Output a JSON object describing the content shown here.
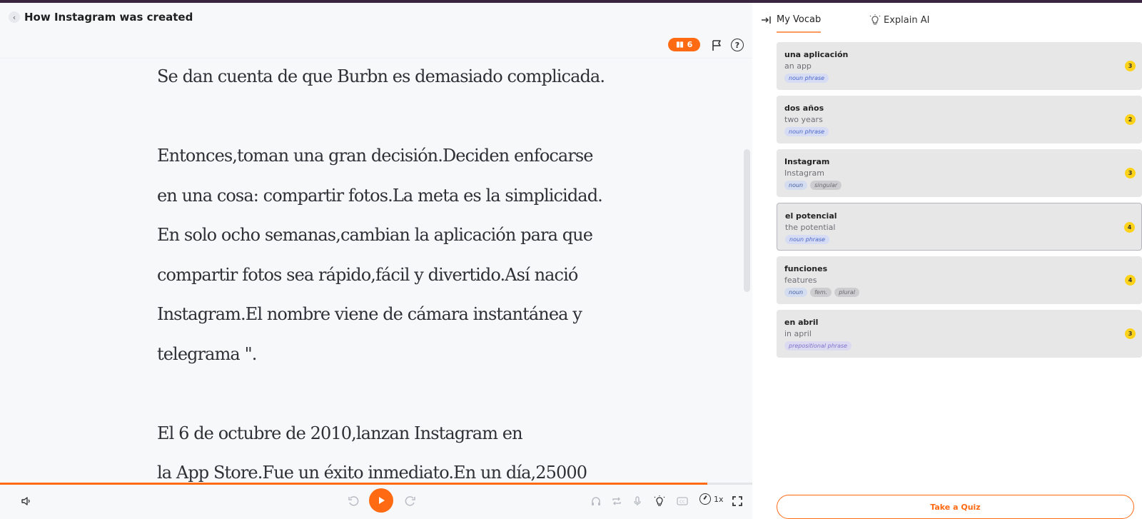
{
  "header": {
    "title": "How Instagram was created",
    "book_count": "6"
  },
  "story": {
    "lines": [
      "Se dan cuenta de que Burbn es demasiado complicada.",
      "",
      "Entonces,toman una gran decisión.Deciden enfocarse",
      "en una cosa: compartir fotos.La meta es la simplicidad.",
      "En solo ocho semanas,cambian la aplicación para que",
      "compartir fotos sea rápido,fácil y divertido.Así nació",
      "Instagram.El nombre viene de cámara instantánea y",
      "telegrama \".",
      "",
      "El 6 de octubre de 2010,lanzan Instagram en",
      "la App Store.Fue un éxito inmediato.En un día,25000"
    ],
    "progress_fraction": 0.94
  },
  "player": {
    "speed_label": "1x"
  },
  "panel": {
    "tab_vocab": "My Vocab",
    "tab_ai": "Explain AI",
    "quiz_label": "Take a Quiz",
    "vocab": [
      {
        "word": "una aplicación",
        "translation": "an app",
        "tags": [
          "noun phrase"
        ],
        "count": "3"
      },
      {
        "word": "dos años",
        "translation": "two years",
        "tags": [
          "noun phrase"
        ],
        "count": "2"
      },
      {
        "word": "Instagram",
        "translation": "Instagram",
        "tags": [
          "noun",
          "singular"
        ],
        "count": "3"
      },
      {
        "word": "el potencial",
        "translation": "the potential",
        "tags": [
          "noun phrase"
        ],
        "count": "4"
      },
      {
        "word": "funciones",
        "translation": "features",
        "tags": [
          "noun",
          "fem.",
          "plural"
        ],
        "count": "4"
      },
      {
        "word": "en abril",
        "translation": "in april",
        "tags": [
          "prepositional phrase"
        ],
        "count": "3"
      }
    ]
  },
  "colors": {
    "accent": "#ff6a13",
    "count_badge": "#fcd31a",
    "card_bg": "#e7e7e8"
  },
  "icons": [
    "chevron-left-icon",
    "book-icon",
    "flag-icon",
    "help-icon",
    "volume-icon",
    "rewind-icon",
    "play-icon",
    "forward-icon",
    "headphones-icon",
    "repeat-icon",
    "mic-icon",
    "bulb-icon",
    "cc-icon",
    "speed-icon",
    "fullscreen-icon",
    "collapse-panel-icon"
  ]
}
